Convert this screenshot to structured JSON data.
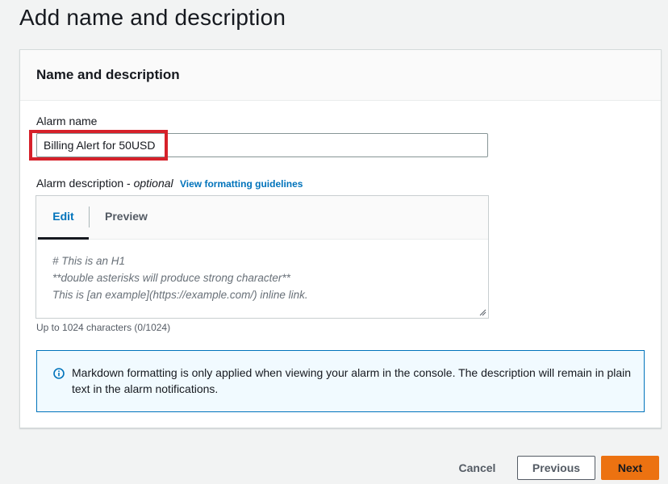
{
  "page": {
    "title": "Add name and description"
  },
  "panel": {
    "title": "Name and description",
    "alarm_name": {
      "label": "Alarm name",
      "value": "Billing Alert for 50USD"
    },
    "alarm_description": {
      "label": "Alarm description - ",
      "optional": "optional",
      "link": "View formatting guidelines",
      "tabs": [
        "Edit",
        "Preview"
      ],
      "active_tab": "Edit",
      "placeholder_lines": [
        "# This is an H1",
        "**double asterisks will produce strong character**",
        "This is [an example](https://example.com/) inline link."
      ],
      "char_count": "Up to 1024 characters (0/1024)"
    },
    "info": {
      "icon": "info-icon",
      "text": "Markdown formatting is only applied when viewing your alarm in the console. The description will remain in plain text in the alarm notifications."
    }
  },
  "footer": {
    "cancel": "Cancel",
    "previous": "Previous",
    "next": "Next"
  },
  "colors": {
    "accent": "#0073bb",
    "primary_button": "#ec7211",
    "highlight": "#d6212a"
  }
}
